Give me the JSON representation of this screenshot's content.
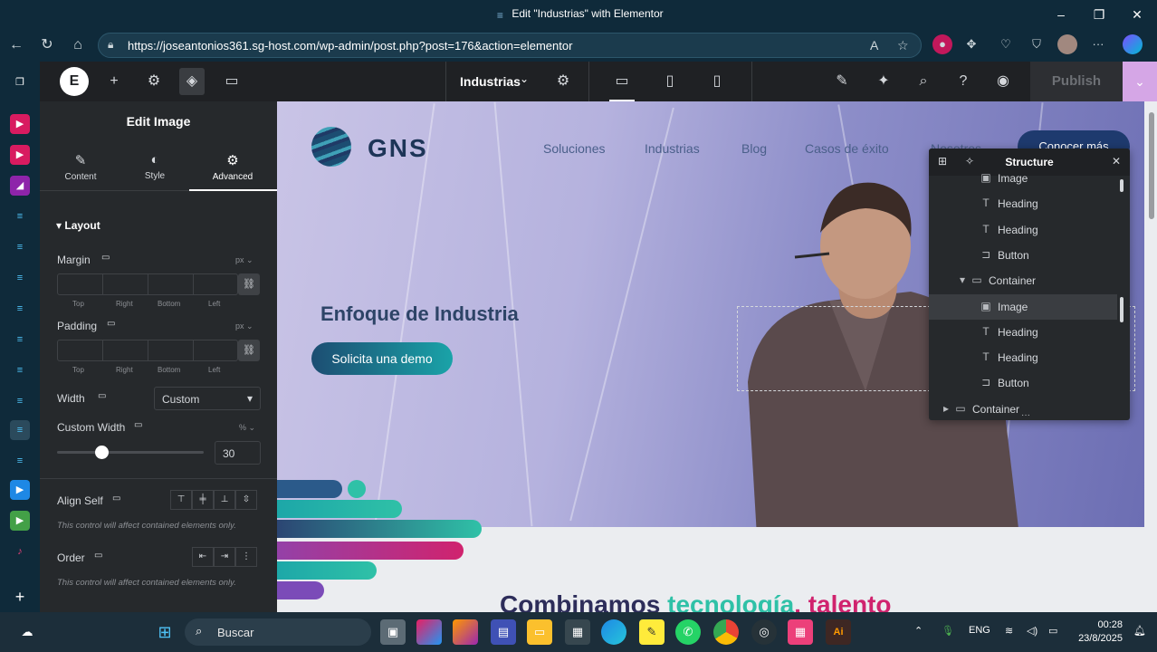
{
  "window": {
    "title": "Edit \"Industrias\" with Elementor"
  },
  "browser": {
    "url": "https://joseantonios361.sg-host.com/wp-admin/post.php?post=176&action=elementor"
  },
  "editor": {
    "page_name": "Industrias",
    "publish_label": "Publish"
  },
  "panel": {
    "title": "Edit Image",
    "tabs": [
      {
        "label": "Content",
        "icon": "pencil-icon"
      },
      {
        "label": "Style",
        "icon": "contrast-icon"
      },
      {
        "label": "Advanced",
        "icon": "gear-icon"
      }
    ],
    "section_title": "Layout",
    "margin": {
      "label": "Margin",
      "unit": "px",
      "fields": [
        "Top",
        "Right",
        "Bottom",
        "Left"
      ]
    },
    "padding": {
      "label": "Padding",
      "unit": "px",
      "fields": [
        "Top",
        "Right",
        "Bottom",
        "Left"
      ]
    },
    "width": {
      "label": "Width",
      "value": "Custom"
    },
    "custom_width": {
      "label": "Custom Width",
      "unit": "%",
      "value": "30",
      "slider_fraction": 0.3
    },
    "align_self": {
      "label": "Align Self",
      "note": "This control will affect contained elements only."
    },
    "order": {
      "label": "Order",
      "note": "This control will affect contained elements only."
    }
  },
  "site": {
    "logo_text": "GNS",
    "nav": [
      "Soluciones",
      "Industrias",
      "Blog",
      "Casos de éxito",
      "Nosotros"
    ],
    "cta": "Conocer más",
    "hero_heading": "Enfoque de Industria",
    "hero_button": "Solicita una demo",
    "section_heading_a": "Combinamos ",
    "section_heading_b": "tecnología",
    "section_heading_c": ", talento"
  },
  "structure": {
    "title": "Structure",
    "rows": [
      {
        "label": "Image",
        "icon": "image-icon",
        "indent": 2
      },
      {
        "label": "Heading",
        "icon": "heading-icon",
        "indent": 2
      },
      {
        "label": "Heading",
        "icon": "heading-icon",
        "indent": 2
      },
      {
        "label": "Button",
        "icon": "button-icon",
        "indent": 2
      },
      {
        "label": "Container",
        "icon": "container-icon",
        "indent": 1
      },
      {
        "label": "Image",
        "icon": "image-icon",
        "indent": 2
      },
      {
        "label": "Heading",
        "icon": "heading-icon",
        "indent": 2
      },
      {
        "label": "Heading",
        "icon": "heading-icon",
        "indent": 2
      },
      {
        "label": "Button",
        "icon": "button-icon",
        "indent": 2
      },
      {
        "label": "Container",
        "icon": "container-icon",
        "indent": 0
      }
    ]
  },
  "taskbar": {
    "search_placeholder": "Buscar",
    "language": "ENG",
    "time": "00:28",
    "date": "23/8/2025"
  },
  "colors": {
    "accent_pink": "#d5a6e6",
    "brand_dark": "#1e3a6e",
    "brand_teal": "#2fc1a7",
    "brand_magenta": "#d0236e"
  }
}
